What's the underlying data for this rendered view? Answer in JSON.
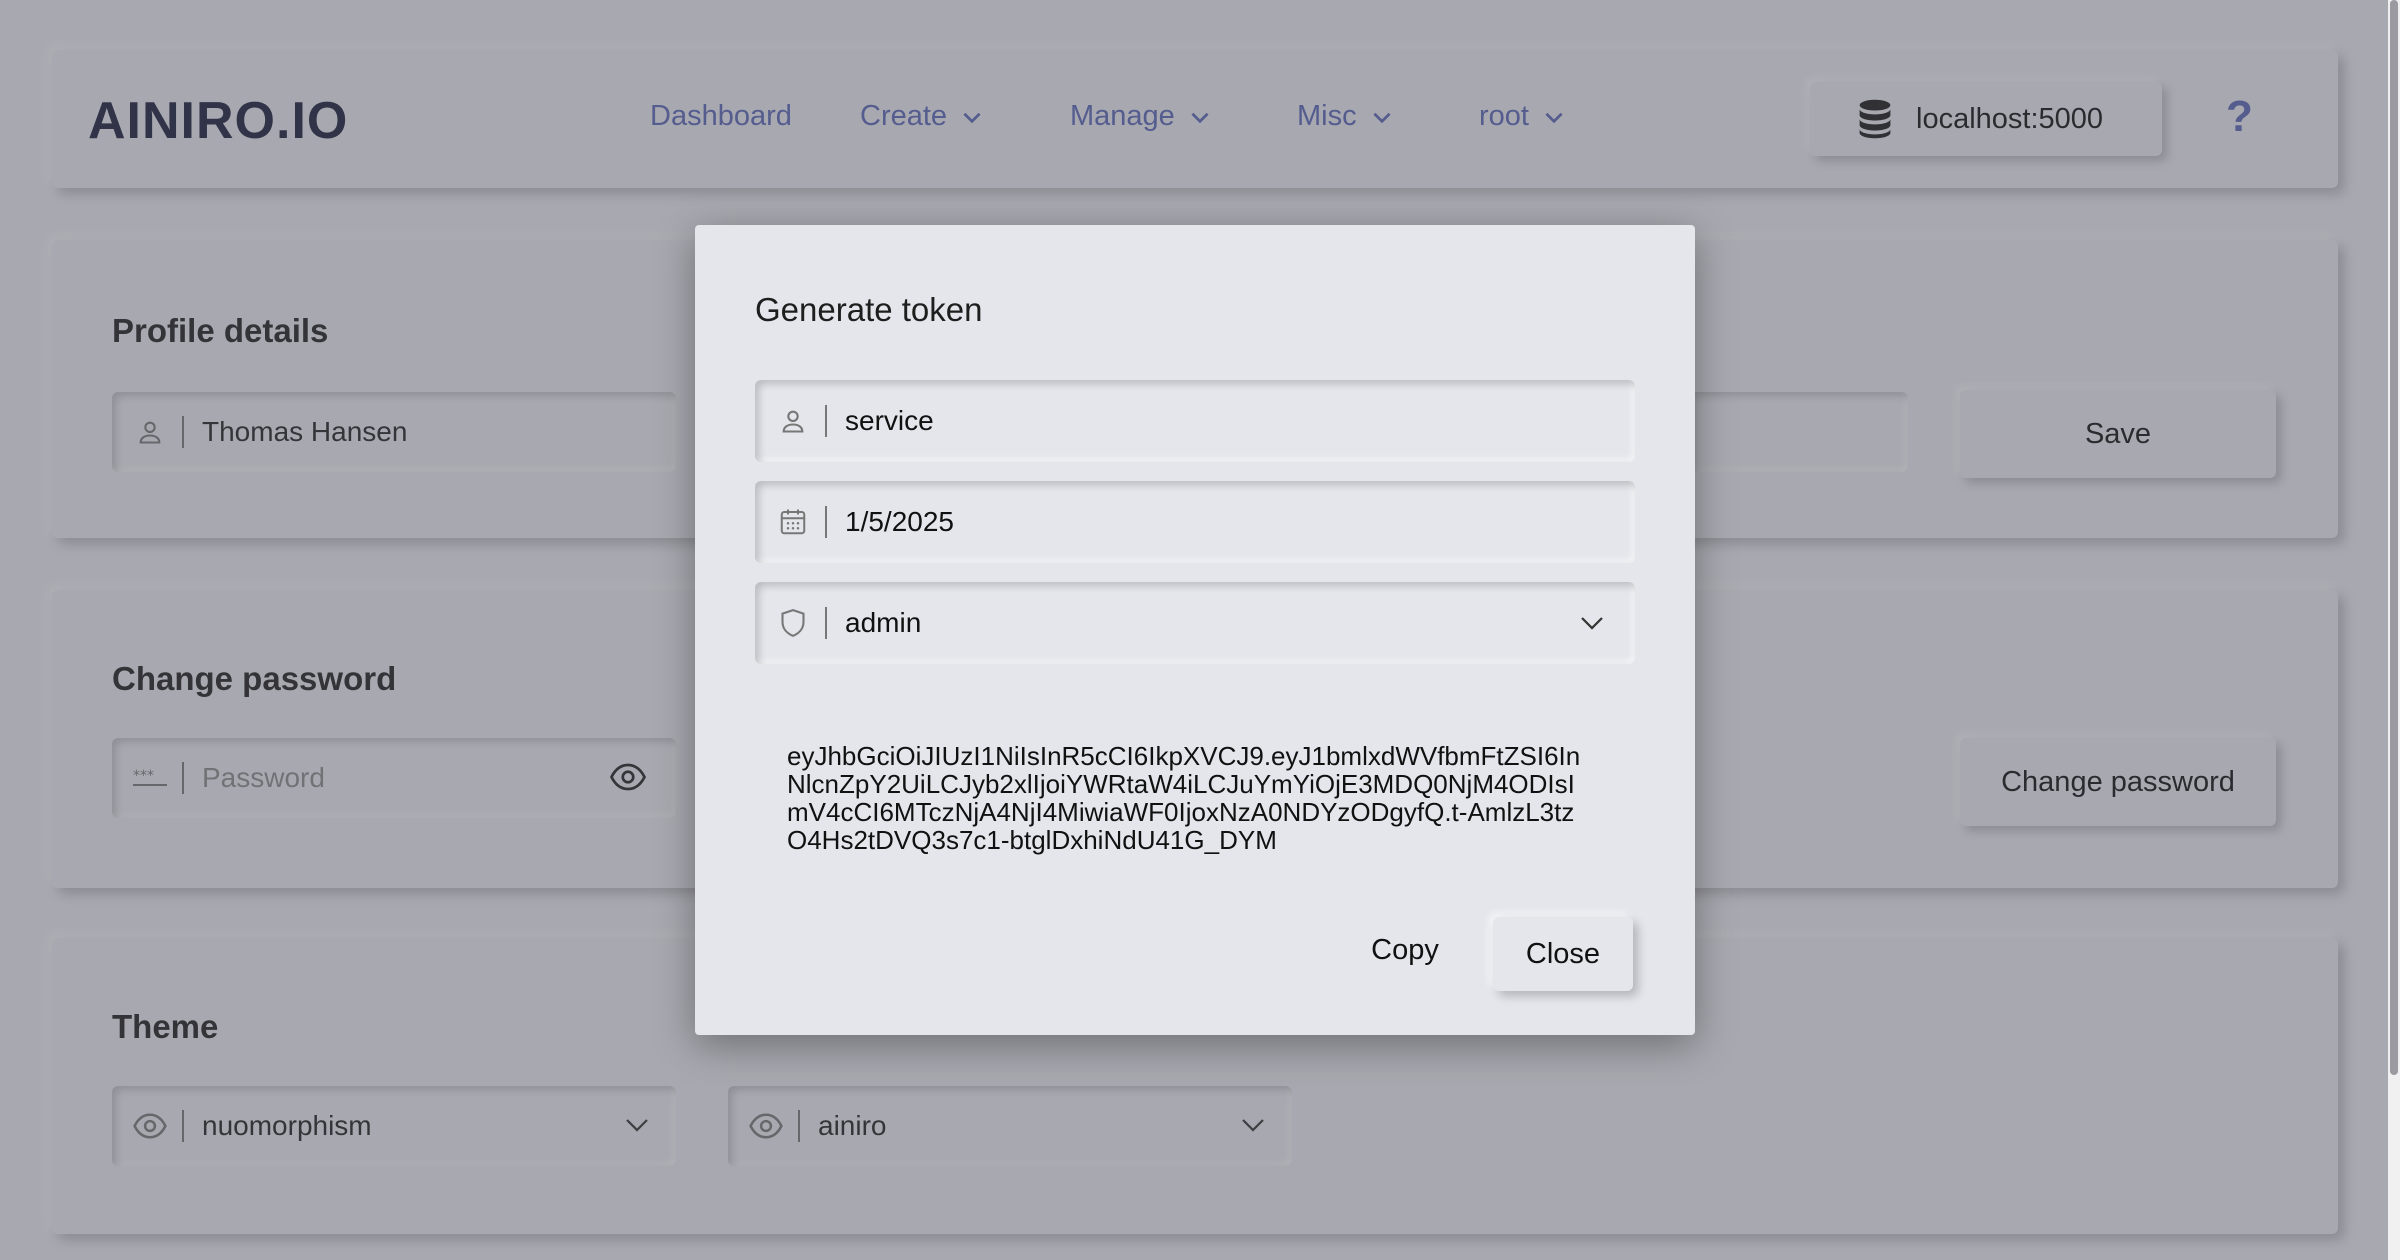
{
  "header": {
    "logo_text": "AINIRO.IO",
    "nav": [
      {
        "label": "Dashboard",
        "has_dropdown": false
      },
      {
        "label": "Create",
        "has_dropdown": true
      },
      {
        "label": "Manage",
        "has_dropdown": true
      },
      {
        "label": "Misc",
        "has_dropdown": true
      },
      {
        "label": "root",
        "has_dropdown": true
      }
    ],
    "server_label": "localhost:5000",
    "help_label": "?"
  },
  "profile": {
    "title": "Profile details",
    "name_value": "Thomas Hansen",
    "save_label": "Save"
  },
  "password": {
    "title": "Change password",
    "placeholder": "Password",
    "button_label": "Change password"
  },
  "theme": {
    "title": "Theme",
    "theme_value": "nuomorphism",
    "accent_value": "ainiro"
  },
  "dialog": {
    "title": "Generate token",
    "username_value": "service",
    "expiry_value": "1/5/2025",
    "role_value": "admin",
    "token": "eyJhbGciOiJIUzI1NiIsInR5cCI6IkpXVCJ9.eyJ1bmlxdWVfbmFtZSI6InNlcnZpY2UiLCJyb2xlIjoiYWRtaW4iLCJuYmYiOjE3MDQ0NjM4ODIsImV4cCI6MTczNjA4NjI4MiwiaWF0IjoxNzA0NDYzODgyfQ.t-AmlzL3tzO4Hs2tDVQ3s7c1-btglDxhiNdU41G_DYM",
    "copy_label": "Copy",
    "close_label": "Close"
  },
  "colors": {
    "nav_accent": "#5864b4",
    "background": "#e7e8ee"
  }
}
